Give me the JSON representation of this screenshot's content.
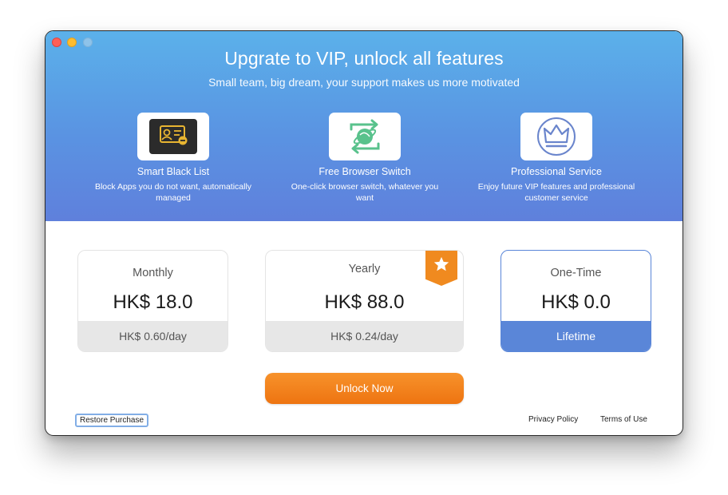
{
  "header": {
    "title": "Upgrate to VIP, unlock all features",
    "subtitle": "Small team, big dream, your support makes us more motivated"
  },
  "features": [
    {
      "name": "Smart Black List",
      "desc": "Block Apps you do not want, automatically managed",
      "icon": "blacklist-card-icon"
    },
    {
      "name": "Free Browser Switch",
      "desc": "One-click browser switch, whatever you want",
      "icon": "browser-switch-icon"
    },
    {
      "name": "Professional Service",
      "desc": "Enjoy future VIP features and professional customer service",
      "icon": "crown-icon"
    }
  ],
  "plans": [
    {
      "name": "Monthly",
      "price": "HK$ 18.0",
      "per_day": "HK$ 0.60/day"
    },
    {
      "name": "Yearly",
      "price": "HK$ 88.0",
      "per_day": "HK$ 0.24/day",
      "badge": "star-icon"
    },
    {
      "name": "One-Time",
      "price": "HK$ 0.0",
      "per_day": "Lifetime",
      "selected": true
    }
  ],
  "actions": {
    "unlock": "Unlock Now",
    "restore": "Restore Purchase",
    "privacy": "Privacy Policy",
    "terms": "Terms of Use"
  },
  "colors": {
    "hero_top": "#5bb1ea",
    "hero_bottom": "#5f80dc",
    "accent_orange": "#f08a1f",
    "selected_blue": "#5a86d8"
  }
}
